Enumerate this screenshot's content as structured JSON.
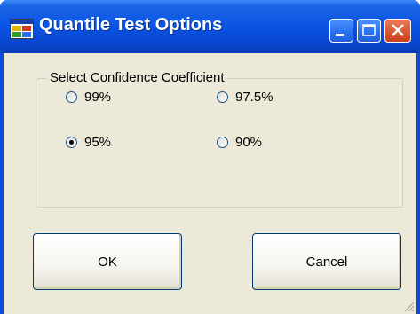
{
  "window": {
    "title": "Quantile Test Options"
  },
  "group": {
    "legend": "Select Confidence Coefficient",
    "options": [
      {
        "label": "99%",
        "selected": false
      },
      {
        "label": "97.5%",
        "selected": false
      },
      {
        "label": "95%",
        "selected": true
      },
      {
        "label": "90%",
        "selected": false
      }
    ]
  },
  "buttons": {
    "ok": "OK",
    "cancel": "Cancel"
  },
  "icons": {
    "app": "app-window-icon",
    "minimize": "minimize-icon",
    "maximize": "maximize-icon",
    "close": "close-icon",
    "grip": "resize-grip-icon"
  },
  "colors": {
    "titlebar": "#0a54e3",
    "client": "#ece9d8",
    "close_button": "#d9542e"
  }
}
